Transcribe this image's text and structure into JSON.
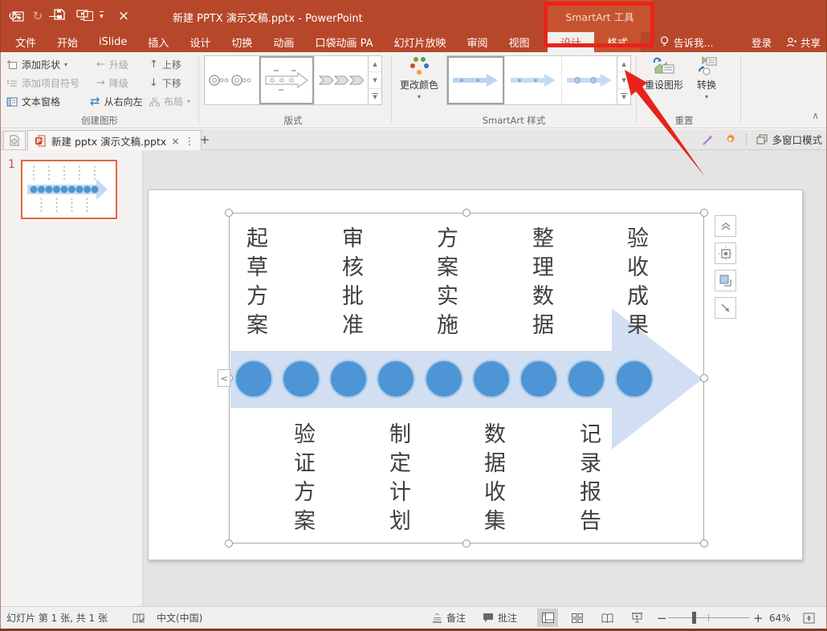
{
  "titlebar": {
    "title": "新建 PPTX 演示文稿.pptx - PowerPoint",
    "contextual_group": "SmartArt 工具"
  },
  "tabs": {
    "items": [
      "文件",
      "开始",
      "iSlide",
      "插入",
      "设计",
      "切换",
      "动画",
      "口袋动画 PA",
      "幻灯片放映",
      "审阅",
      "视图"
    ],
    "contextual": [
      "设计",
      "格式"
    ],
    "tell_me": "告诉我...",
    "sign_in": "登录",
    "share": "共享"
  },
  "ribbon": {
    "create_graphic": {
      "label": "创建图形",
      "add_shape": "添加形状",
      "add_bullet": "添加项目符号",
      "text_pane": "文本窗格",
      "promote": "升级",
      "demote": "降级",
      "right_to_left": "从右向左",
      "move_up": "上移",
      "move_down": "下移",
      "layout": "布局"
    },
    "layouts": {
      "label": "版式"
    },
    "styles": {
      "label": "SmartArt 样式",
      "change_colors": "更改颜色"
    },
    "reset": {
      "label": "重置",
      "reset_graphic": "重设图形",
      "convert": "转换"
    }
  },
  "doc_tabbar": {
    "tab_title": "新建 pptx 演示文稿.pptx",
    "multi_window": "多窗口模式"
  },
  "slides_panel": {
    "slide_number": "1"
  },
  "smartart": {
    "top_labels": [
      "起草方案",
      "审核批准",
      "方案实施",
      "整理数据",
      "验收成果"
    ],
    "bottom_labels": [
      "验证方案",
      "制定计划",
      "数据收集",
      "记录报告"
    ]
  },
  "status_bar": {
    "slide_info": "幻灯片 第 1 张, 共 1 张",
    "language": "中文(中国)",
    "notes": "备注",
    "comments": "批注",
    "zoom_level": "64%"
  },
  "glyphs": {
    "undo": "↺",
    "redo": "↻",
    "dropdown": "▾",
    "promote_arrow": "←",
    "demote_arrow": "→",
    "up_arrow": "↑",
    "down_arrow": "↓",
    "rtl_arrow": "⇄",
    "close": "×",
    "tab_close": "×",
    "tab_menu": "⋮",
    "new_tab": "+",
    "collapse_ribbon": "∧",
    "gallery_up": "▲",
    "gallery_down": "▼",
    "gallery_more": "▼",
    "pane_toggle": "<",
    "zoom_out": "−",
    "zoom_in": "+",
    "minimize": "—"
  },
  "colors": {
    "accent_red": "#B7472A",
    "annotation_red": "#E8231A",
    "shape_blue": "#4E95D5",
    "arrow_light_blue": "#D2DEF1"
  }
}
